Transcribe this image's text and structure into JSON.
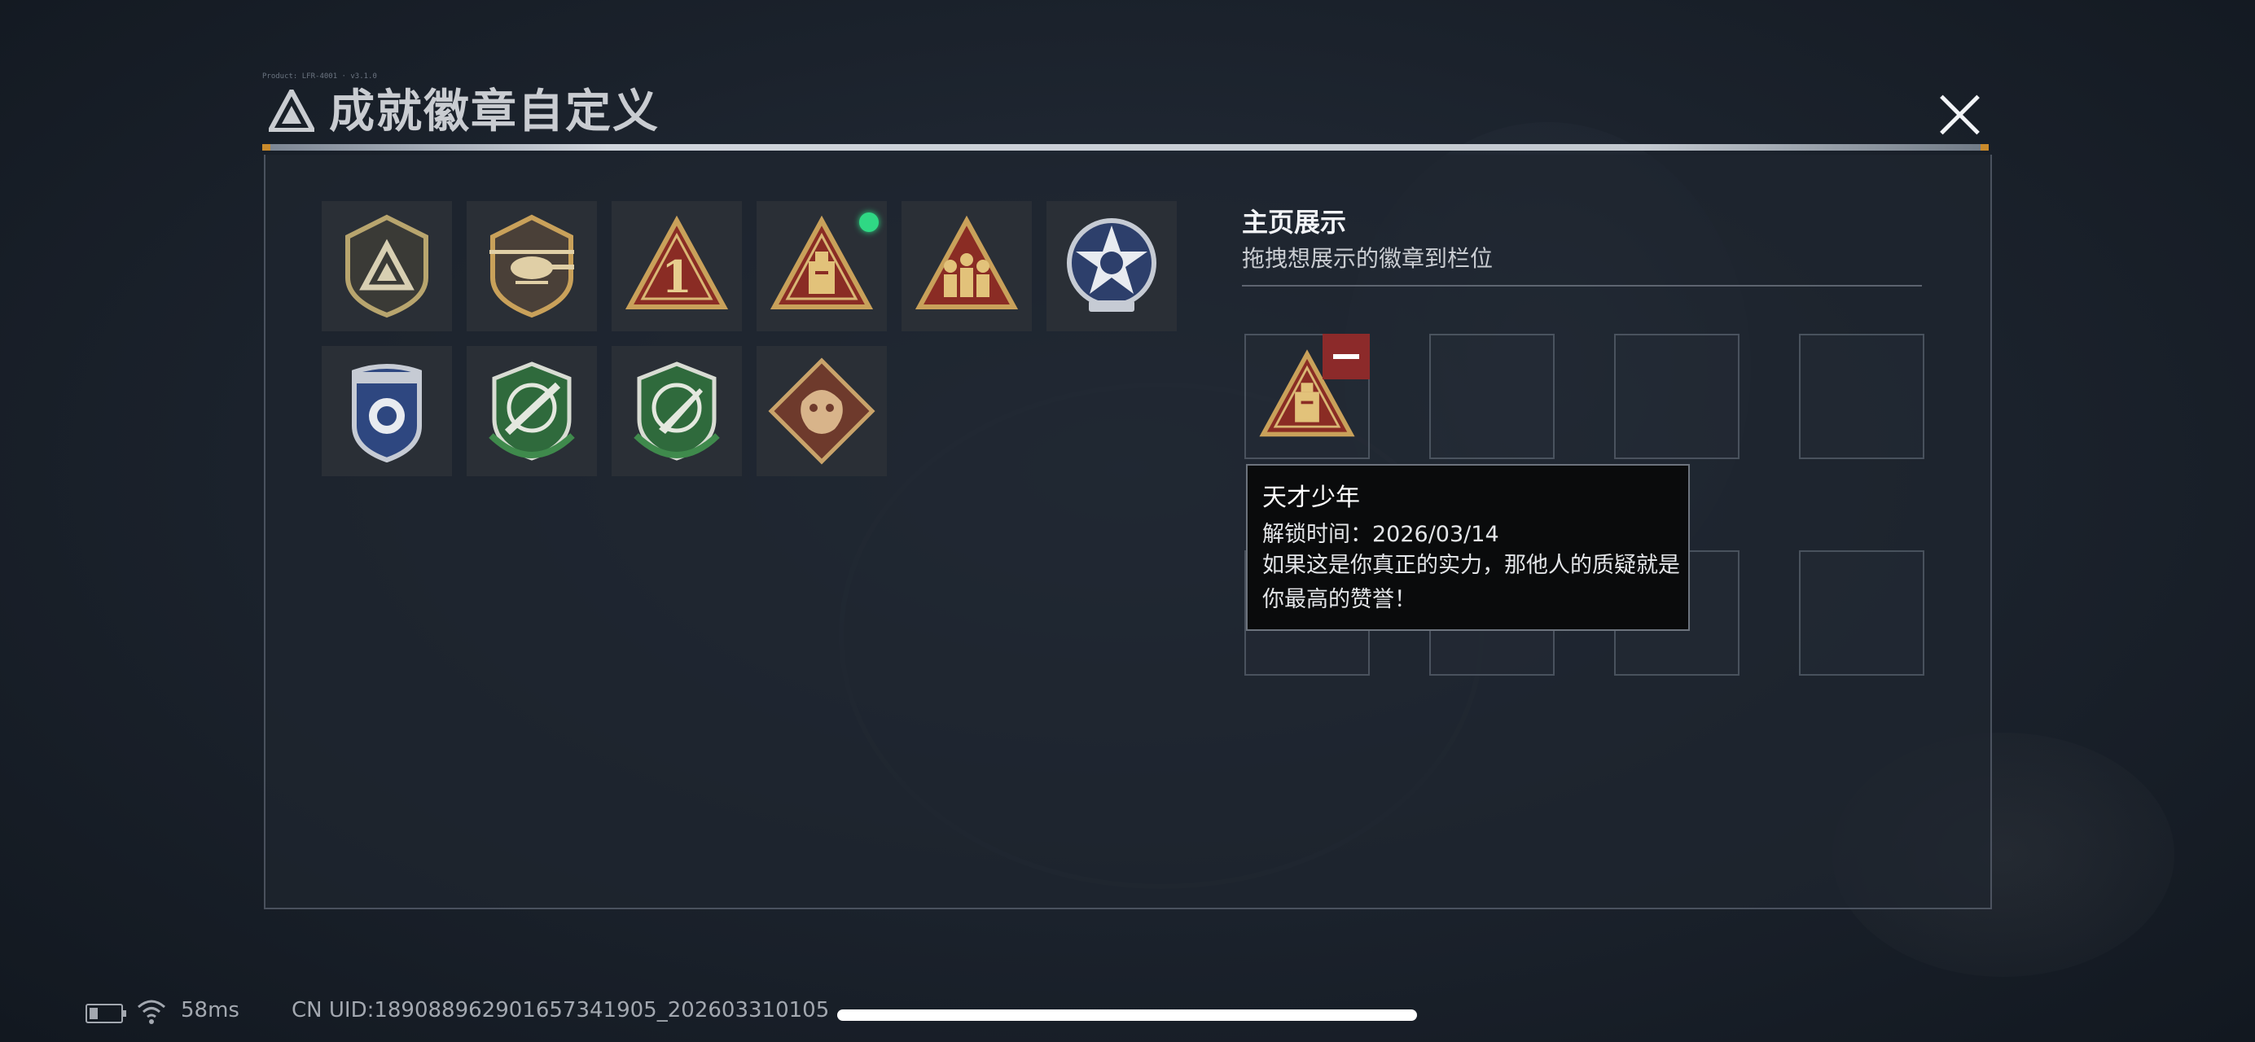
{
  "header": {
    "title": "成就徽章自定义",
    "tiny_text": "Product: LFR-4001 · v3.1.0"
  },
  "badges": [
    {
      "name": "logo-shield",
      "selected": false
    },
    {
      "name": "helicopter",
      "selected": false
    },
    {
      "name": "number-one",
      "selected": false
    },
    {
      "name": "genius-youth",
      "selected": true
    },
    {
      "name": "squad",
      "selected": false
    },
    {
      "name": "star-emblem",
      "selected": false
    },
    {
      "name": "police-shield",
      "selected": false
    },
    {
      "name": "rifle-crosshair",
      "selected": false
    },
    {
      "name": "knife-crosshair",
      "selected": false
    },
    {
      "name": "dragon",
      "selected": false
    }
  ],
  "display": {
    "title": "主页展示",
    "subtitle": "拖拽想展示的徽章到栏位",
    "slots": [
      "genius-youth",
      "",
      "",
      "",
      "",
      "",
      "",
      ""
    ]
  },
  "tooltip": {
    "name": "天才少年",
    "unlock_label": "解锁时间：",
    "unlock_date": "2026/03/14",
    "description": "如果这是你真正的实力，那他人的质疑就是你最高的赞誉！"
  },
  "status": {
    "ping": "58ms",
    "uid": "CN UID:18908896290165734​1905_202603310105"
  },
  "colors": {
    "gold": "#c9a15a",
    "red": "#8c2a2a",
    "green": "#2fd884",
    "panel": "#1e252f"
  }
}
